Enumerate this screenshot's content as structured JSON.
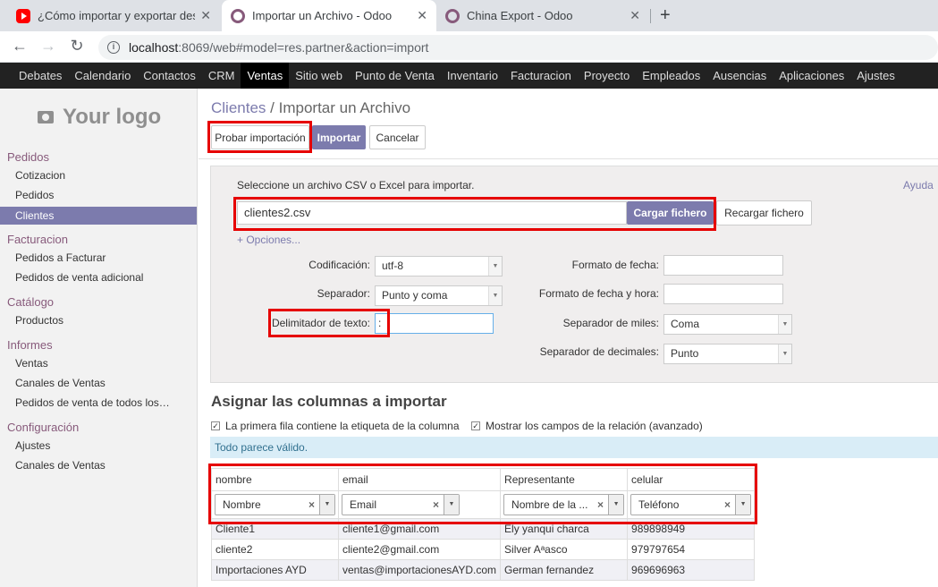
{
  "browser": {
    "tabs": [
      {
        "title": "¿Cómo importar y exportar desde",
        "icon": "youtube-icon"
      },
      {
        "title": "Importar un Archivo - Odoo",
        "icon": "odoo-icon"
      },
      {
        "title": "China Export - Odoo",
        "icon": "odoo-icon"
      }
    ],
    "close_glyph": "✕",
    "new_tab_glyph": "+",
    "back_glyph": "←",
    "forward_glyph": "→",
    "reload_glyph": "↻",
    "url_host": "localhost",
    "url_rest": ":8069/web#model=res.partner&action=import"
  },
  "menu": [
    "Debates",
    "Calendario",
    "Contactos",
    "CRM",
    "Ventas",
    "Sitio web",
    "Punto de Venta",
    "Inventario",
    "Facturacion",
    "Proyecto",
    "Empleados",
    "Ausencias",
    "Aplicaciones",
    "Ajustes"
  ],
  "sidebar": {
    "logo": "Your logo",
    "sections": [
      {
        "title": "Pedidos",
        "items": [
          "Cotizacion",
          "Pedidos",
          "Clientes"
        ]
      },
      {
        "title": "Facturacion",
        "items": [
          "Pedidos a Facturar",
          "Pedidos de venta adicional"
        ]
      },
      {
        "title": "Catálogo",
        "items": [
          "Productos"
        ]
      },
      {
        "title": "Informes",
        "items": [
          "Ventas",
          "Canales de Ventas",
          "Pedidos de venta de todos los…"
        ]
      },
      {
        "title": "Configuración",
        "items": [
          "Ajustes",
          "Canales de Ventas"
        ]
      }
    ]
  },
  "page": {
    "breadcrumb_link": "Clientes",
    "breadcrumb_sep": "/",
    "breadcrumb_current": "Importar un Archivo",
    "btn_test": "Probar importación",
    "btn_import": "Importar",
    "btn_cancel": "Cancelar"
  },
  "upload": {
    "prompt": "Seleccione un archivo CSV o Excel para importar.",
    "help": "Ayuda",
    "file_name": "clientes2.csv",
    "btn_load": "Cargar fichero",
    "btn_reload": "Recargar fichero",
    "options_link": "+ Opciones..."
  },
  "options": {
    "encoding_label": "Codificación:",
    "encoding_value": "utf-8",
    "separator_label": "Separador:",
    "separator_value": "Punto y coma",
    "text_delim_label": "Delimitador de texto:",
    "text_delim_value": ":",
    "date_format_label": "Formato de fecha:",
    "datetime_format_label": "Formato de fecha y hora:",
    "thousands_label": "Separador de miles:",
    "thousands_value": "Coma",
    "decimal_label": "Separador de decimales:",
    "decimal_value": "Punto",
    "arrow_glyph": "▼"
  },
  "mapping": {
    "title": "Asignar las columnas a importar",
    "chk_first_row": "La primera fila contiene la etiqueta de la columna",
    "chk_relation": "Mostrar los campos de la relación (avanzado)",
    "check_glyph": "✓",
    "status": "Todo parece válido.",
    "clear_glyph": "×",
    "columns": [
      {
        "header": "nombre",
        "field": "Nombre"
      },
      {
        "header": "email",
        "field": "Email"
      },
      {
        "header": "Representante",
        "field": "Nombre de la ..."
      },
      {
        "header": "celular",
        "field": "Teléfono"
      }
    ],
    "rows": [
      [
        "Cliente1",
        "cliente1@gmail.com",
        "Ely yanqui charca",
        "989898949"
      ],
      [
        "cliente2",
        "cliente2@gmail.com",
        "Silver Aᵃasco",
        "979797654"
      ],
      [
        "Importaciones AYD",
        "ventas@importacionesAYD.com",
        "German fernandez",
        "969696963"
      ]
    ]
  }
}
